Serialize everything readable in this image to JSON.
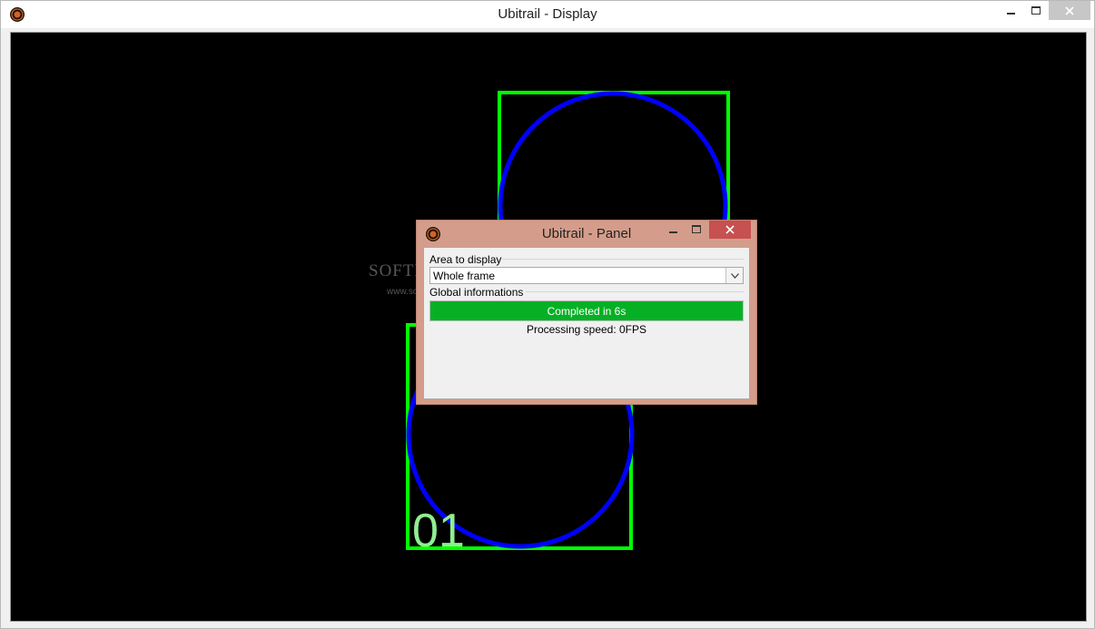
{
  "main_window": {
    "title": "Ubitrail - Display",
    "icon": "ubitrail-logo-icon",
    "controls": {
      "minimize": "minimize-icon",
      "maximize": "maximize-icon",
      "close": "close-icon"
    }
  },
  "display": {
    "track_label": "01",
    "watermark_text": "SOFTP",
    "watermark_url": "www.so"
  },
  "panel": {
    "title": "Ubitrail - Panel",
    "icon": "ubitrail-logo-icon",
    "area_group_label": "Area to display",
    "area_selected": "Whole frame",
    "global_group_label": "Global informations",
    "progress_label": "Completed in 6s",
    "progress_fraction": 1.0,
    "processing_speed": "Processing speed: 0FPS"
  },
  "colors": {
    "bounding_box": "#00ff00",
    "detected_circle": "#0000ff",
    "track_label": "#90ee90",
    "progress_fill": "#06b025",
    "panel_frame": "#d49d8b",
    "panel_close": "#c75050",
    "canvas_background": "#000000"
  }
}
